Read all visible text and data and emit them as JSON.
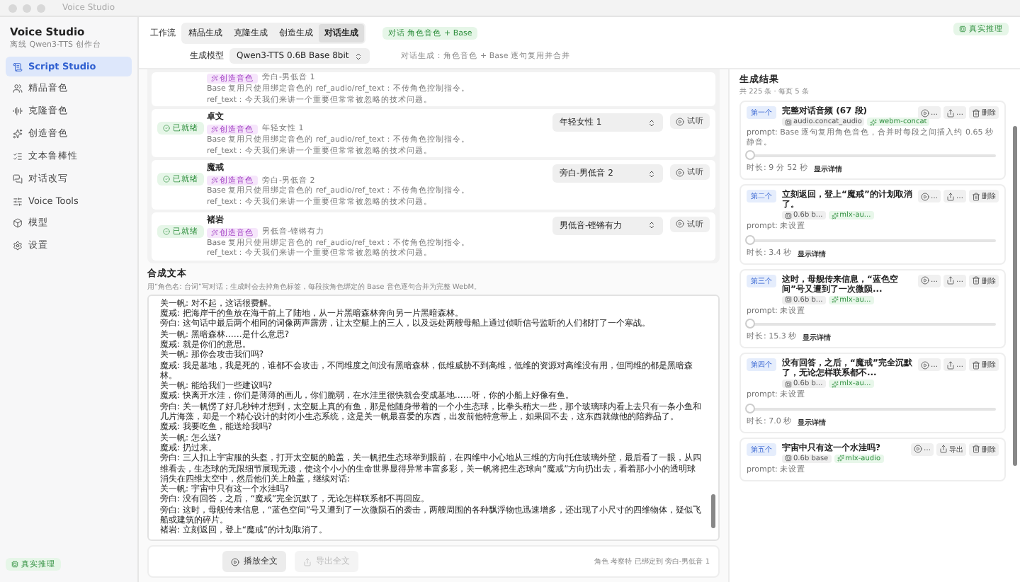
{
  "window": {
    "title": "Voice Studio"
  },
  "sidebar": {
    "title": "Voice Studio",
    "subtitle": "离线 Qwen3-TTS 创作台",
    "items": [
      {
        "label": "Script Studio",
        "selected": true
      },
      {
        "label": "精品音色",
        "selected": false
      },
      {
        "label": "克隆音色",
        "selected": false
      },
      {
        "label": "创造音色",
        "selected": false
      },
      {
        "label": "文本鲁棒性",
        "selected": false
      },
      {
        "label": "对话改写",
        "selected": false
      },
      {
        "label": "Voice Tools",
        "selected": false
      },
      {
        "label": "模型",
        "selected": false
      },
      {
        "label": "设置",
        "selected": false
      }
    ],
    "status": "真实推理"
  },
  "toolbar": {
    "workflow_label": "工作流",
    "tabs": [
      {
        "label": "精品生成",
        "selected": false
      },
      {
        "label": "克隆生成",
        "selected": false
      },
      {
        "label": "创造生成",
        "selected": false
      },
      {
        "label": "对话生成",
        "selected": true
      }
    ],
    "mode_badge": "对话 角色音色 + Base",
    "model_label": "生成模型",
    "model": "Qwen3-TTS 0.6B Base 8bit",
    "model_note": "对话生成：角色音色 + Base 逐句复用并合并",
    "status": "真实推理"
  },
  "roles": [
    {
      "tag": "创造音色",
      "voice": "旁白-男低音 1",
      "desc": [
        "Base 复用只使用绑定音色的 ref_audio/ref_text：不传角色控制指令。",
        "ref_text：今天我们来讲一个重要但常常被忽略的技术问题。"
      ]
    },
    {
      "status": "已就绪",
      "name": "卓文",
      "tag": "创造音色",
      "voice": "年轻女性 1",
      "desc": [
        "Base 复用只使用绑定音色的 ref_audio/ref_text：不传角色控制指令。",
        "ref_text：今天我们来讲一个重要但常常被忽略的技术问题。"
      ],
      "select": "年轻女性 1",
      "button": "试听"
    },
    {
      "status": "已就绪",
      "name": "魔戒",
      "tag": "创造音色",
      "voice": "旁白-男低音 2",
      "desc": [
        "Base 复用只使用绑定音色的 ref_audio/ref_text：不传角色控制指令。",
        "ref_text：今天我们来讲一个重要但常常被忽略的技术问题。"
      ],
      "select": "旁白-男低音 2",
      "button": "试听"
    },
    {
      "status": "已就绪",
      "name": "褚岩",
      "tag": "创造音色",
      "voice": "男低音-铿锵有力",
      "desc": [
        "Base 复用只使用绑定音色的 ref_audio/ref_text：不传角色控制指令。",
        "ref_text：今天我们来讲一个重要但常常被忽略的技术问题。"
      ],
      "select": "男低音-铿锵有力",
      "button": "试听"
    }
  ],
  "script": {
    "title": "合成文本",
    "hint": "用“角色名: 台词”写对话；生成时会去掉角色标签，每段按角色绑定的 Base 音色逐句合并为完整 WebM。",
    "lines": [
      "关一帆: 对不起，这话很费解。",
      "魔戒: 把海岸干的鱼放在海干前上了陆地，从一片黑暗森林奔向另一片黑暗森林。",
      "旁白: 这句话中最后两个相同的词像两声霹雳，让太空艇上的三人，以及远处两艘母船上通过侦听信号监听的人们都打了一个寒战。",
      "关一帆: 黑暗森林……是什么意思?",
      "魔戒: 就是你们的意思。",
      "关一帆: 那你会攻击我们吗?",
      "魔戒: 我是墓地，我是死的，谁都不会攻击，不同维度之间没有黑暗森林，低维威胁不到高维，低维的资源对高维没有用，但同维的都是黑暗森林。",
      "关一帆: 能给我们一些建议吗?",
      "魔戒: 快离开水洼，你们是薄薄的画儿，你们脆弱，在水洼里很快就会变成墓地……呀，你的小船上好像有鱼。",
      "旁白: 关一帆愣了好几秒钟才想到，太空艇上真的有鱼，那是他随身带着的一个小生态球，比拳头稍大一些，那个玻璃球内看上去只有一条小鱼和几片海藻，却是一个精心设计的封闭小生态系统，这是关一帆最喜爱的东西，出发前他特意带上，如果回不去，这东西就做他的陪葬品了。",
      "魔戒: 我要吃鱼，能送给我吗?",
      "关一帆: 怎么送?",
      "魔戒: 扔过来。",
      "旁白: 三人扣上宇宙服的头盔，打开太空艇的舱盖，关一帆把生态球举到眼前，在四维中小心地从三维的方向托住玻璃外壁，最后看了一眼，从四维看去，生态球的无限细节展现无遗，使这个小小的生命世界显得异常丰富多彩，关一帆将把生态球向“魔戒”方向扔出去，看着那小小的透明球消失在四维太空中，然后他们关上舱盖，继续对话:",
      "关一帆: 宇宙中只有这一个水洼吗?",
      "旁白: 没有回答，之后，“魔戒”完全沉默了，无论怎样联系都不再回应。",
      "旁白: 这时，母舰传来信息，“蓝色空间”号又遭到了一次微陨石的袭击，两艘周围的各种飘浮物也迅速增多，还出现了小尺寸的四维物体，疑似飞船或建筑的碎片。",
      "褚岩: 立刻返回，登上“魔戒”的计划取消了。"
    ]
  },
  "footer": {
    "buttons": [
      {
        "label": "播放全文",
        "disabled": false
      },
      {
        "label": "导出全文",
        "disabled": true
      }
    ],
    "note": "角色 考察特 已绑定到 旁白-男低音 1"
  },
  "results": {
    "title": "生成结果",
    "count": "共 225 条 · 每页 5 条",
    "items": [
      {
        "badge": "第一个",
        "title": "完整对话音频 (67 段)",
        "chips": [
          "audio.concat_audio",
          "webm-concat"
        ],
        "actions": [
          "…",
          "…",
          "删除"
        ],
        "prompt": "prompt: Base 逐句复用角色音色，合并时每段之间插入约 0.65 秒静音。",
        "level": 0,
        "duration": "时长: 9 分 52 秒",
        "details": "显示详情"
      },
      {
        "badge": "第二个",
        "title": "立刻返回，登上“魔戒”的计划取消了。",
        "chips": [
          "0.6b b...",
          "mlx-au..."
        ],
        "actions": [
          "…",
          "…",
          "删除"
        ],
        "prompt": "prompt: 未设置",
        "level": 0,
        "duration": "时长: 3.4 秒",
        "details": "显示详情"
      },
      {
        "badge": "第三个",
        "title": "这时，母舰传来信息，“蓝色空间”号又遭到了一次微陨...",
        "chips": [
          "0.6b b...",
          "mlx-au..."
        ],
        "actions": [
          "…",
          "…",
          "删除"
        ],
        "prompt": "prompt: 未设置",
        "level": 0,
        "duration": "时长: 15.3 秒",
        "details": "显示详情"
      },
      {
        "badge": "第四个",
        "title": "没有回答，之后，“魔戒”完全沉默了，无论怎样联系都不...",
        "chips": [
          "0.6b b...",
          "mlx-au..."
        ],
        "actions": [
          "…",
          "…",
          "删除"
        ],
        "prompt": "prompt: 未设置",
        "level": 0,
        "duration": "时长: 7.0 秒",
        "details": "显示详情"
      },
      {
        "badge": "第五个",
        "title": "宇宙中只有这一个水洼吗?",
        "chips": [
          "0.6b base",
          "mlx-audio"
        ],
        "actions": [
          "…",
          "导出",
          "删除"
        ],
        "prompt": "prompt: 未设置"
      }
    ]
  }
}
